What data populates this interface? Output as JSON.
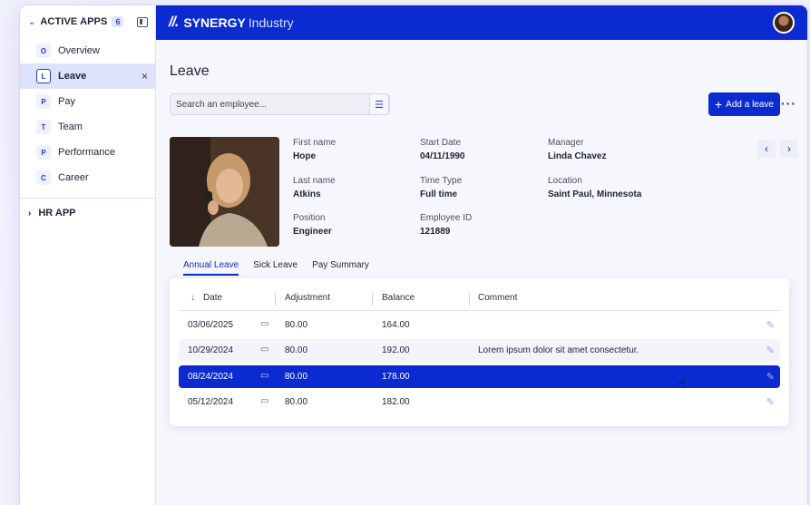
{
  "sidebar": {
    "section_title": "ACTIVE APPS",
    "count": "6",
    "items": [
      {
        "letter": "O",
        "label": "Overview"
      },
      {
        "letter": "L",
        "label": "Leave"
      },
      {
        "letter": "P",
        "label": "Pay"
      },
      {
        "letter": "T",
        "label": "Team"
      },
      {
        "letter": "P",
        "label": "Performance"
      },
      {
        "letter": "C",
        "label": "Career"
      }
    ],
    "close_glyph": "×",
    "hr_app": "HR APP"
  },
  "topbar": {
    "logo_mark": "//.",
    "brand_strong": "SYNERGY",
    "brand_light": "Industry"
  },
  "page": {
    "title": "Leave",
    "search_placeholder": "Search an employee...",
    "add_button": "Add a leave",
    "more": "···"
  },
  "employee": {
    "first_name_label": "First name",
    "first_name": "Hope",
    "last_name_label": "Last name",
    "last_name": "Atkins",
    "position_label": "Position",
    "position": "Engineer",
    "start_date_label": "Start Date",
    "start_date": "04/11/1990",
    "time_type_label": "Time Type",
    "time_type": "Full time",
    "employee_id_label": "Employee ID",
    "employee_id": "121889",
    "manager_label": "Manager",
    "manager": "Linda Chavez",
    "location_label": "Location",
    "location": "Saint Paul, Minnesota"
  },
  "tabs": [
    "Annual Leave",
    "Sick Leave",
    "Pay Summary"
  ],
  "table": {
    "columns": [
      "Date",
      "Adjustment",
      "Balance",
      "Comment"
    ],
    "sort_glyph": "↓",
    "rows": [
      {
        "date": "03/06/2025",
        "adjustment": "80.00",
        "balance": "164.00",
        "comment": ""
      },
      {
        "date": "10/29/2024",
        "adjustment": "80.00",
        "balance": "192.00",
        "comment": "Lorem ipsum dolor sit amet consectetur."
      },
      {
        "date": "08/24/2024",
        "adjustment": "80.00",
        "balance": "178.00",
        "comment": ""
      },
      {
        "date": "05/12/2024",
        "adjustment": "80.00",
        "balance": "182.00",
        "comment": ""
      }
    ]
  },
  "colors": {
    "accent": "#0b2bd1",
    "selected_row": "#0b2bd1"
  }
}
